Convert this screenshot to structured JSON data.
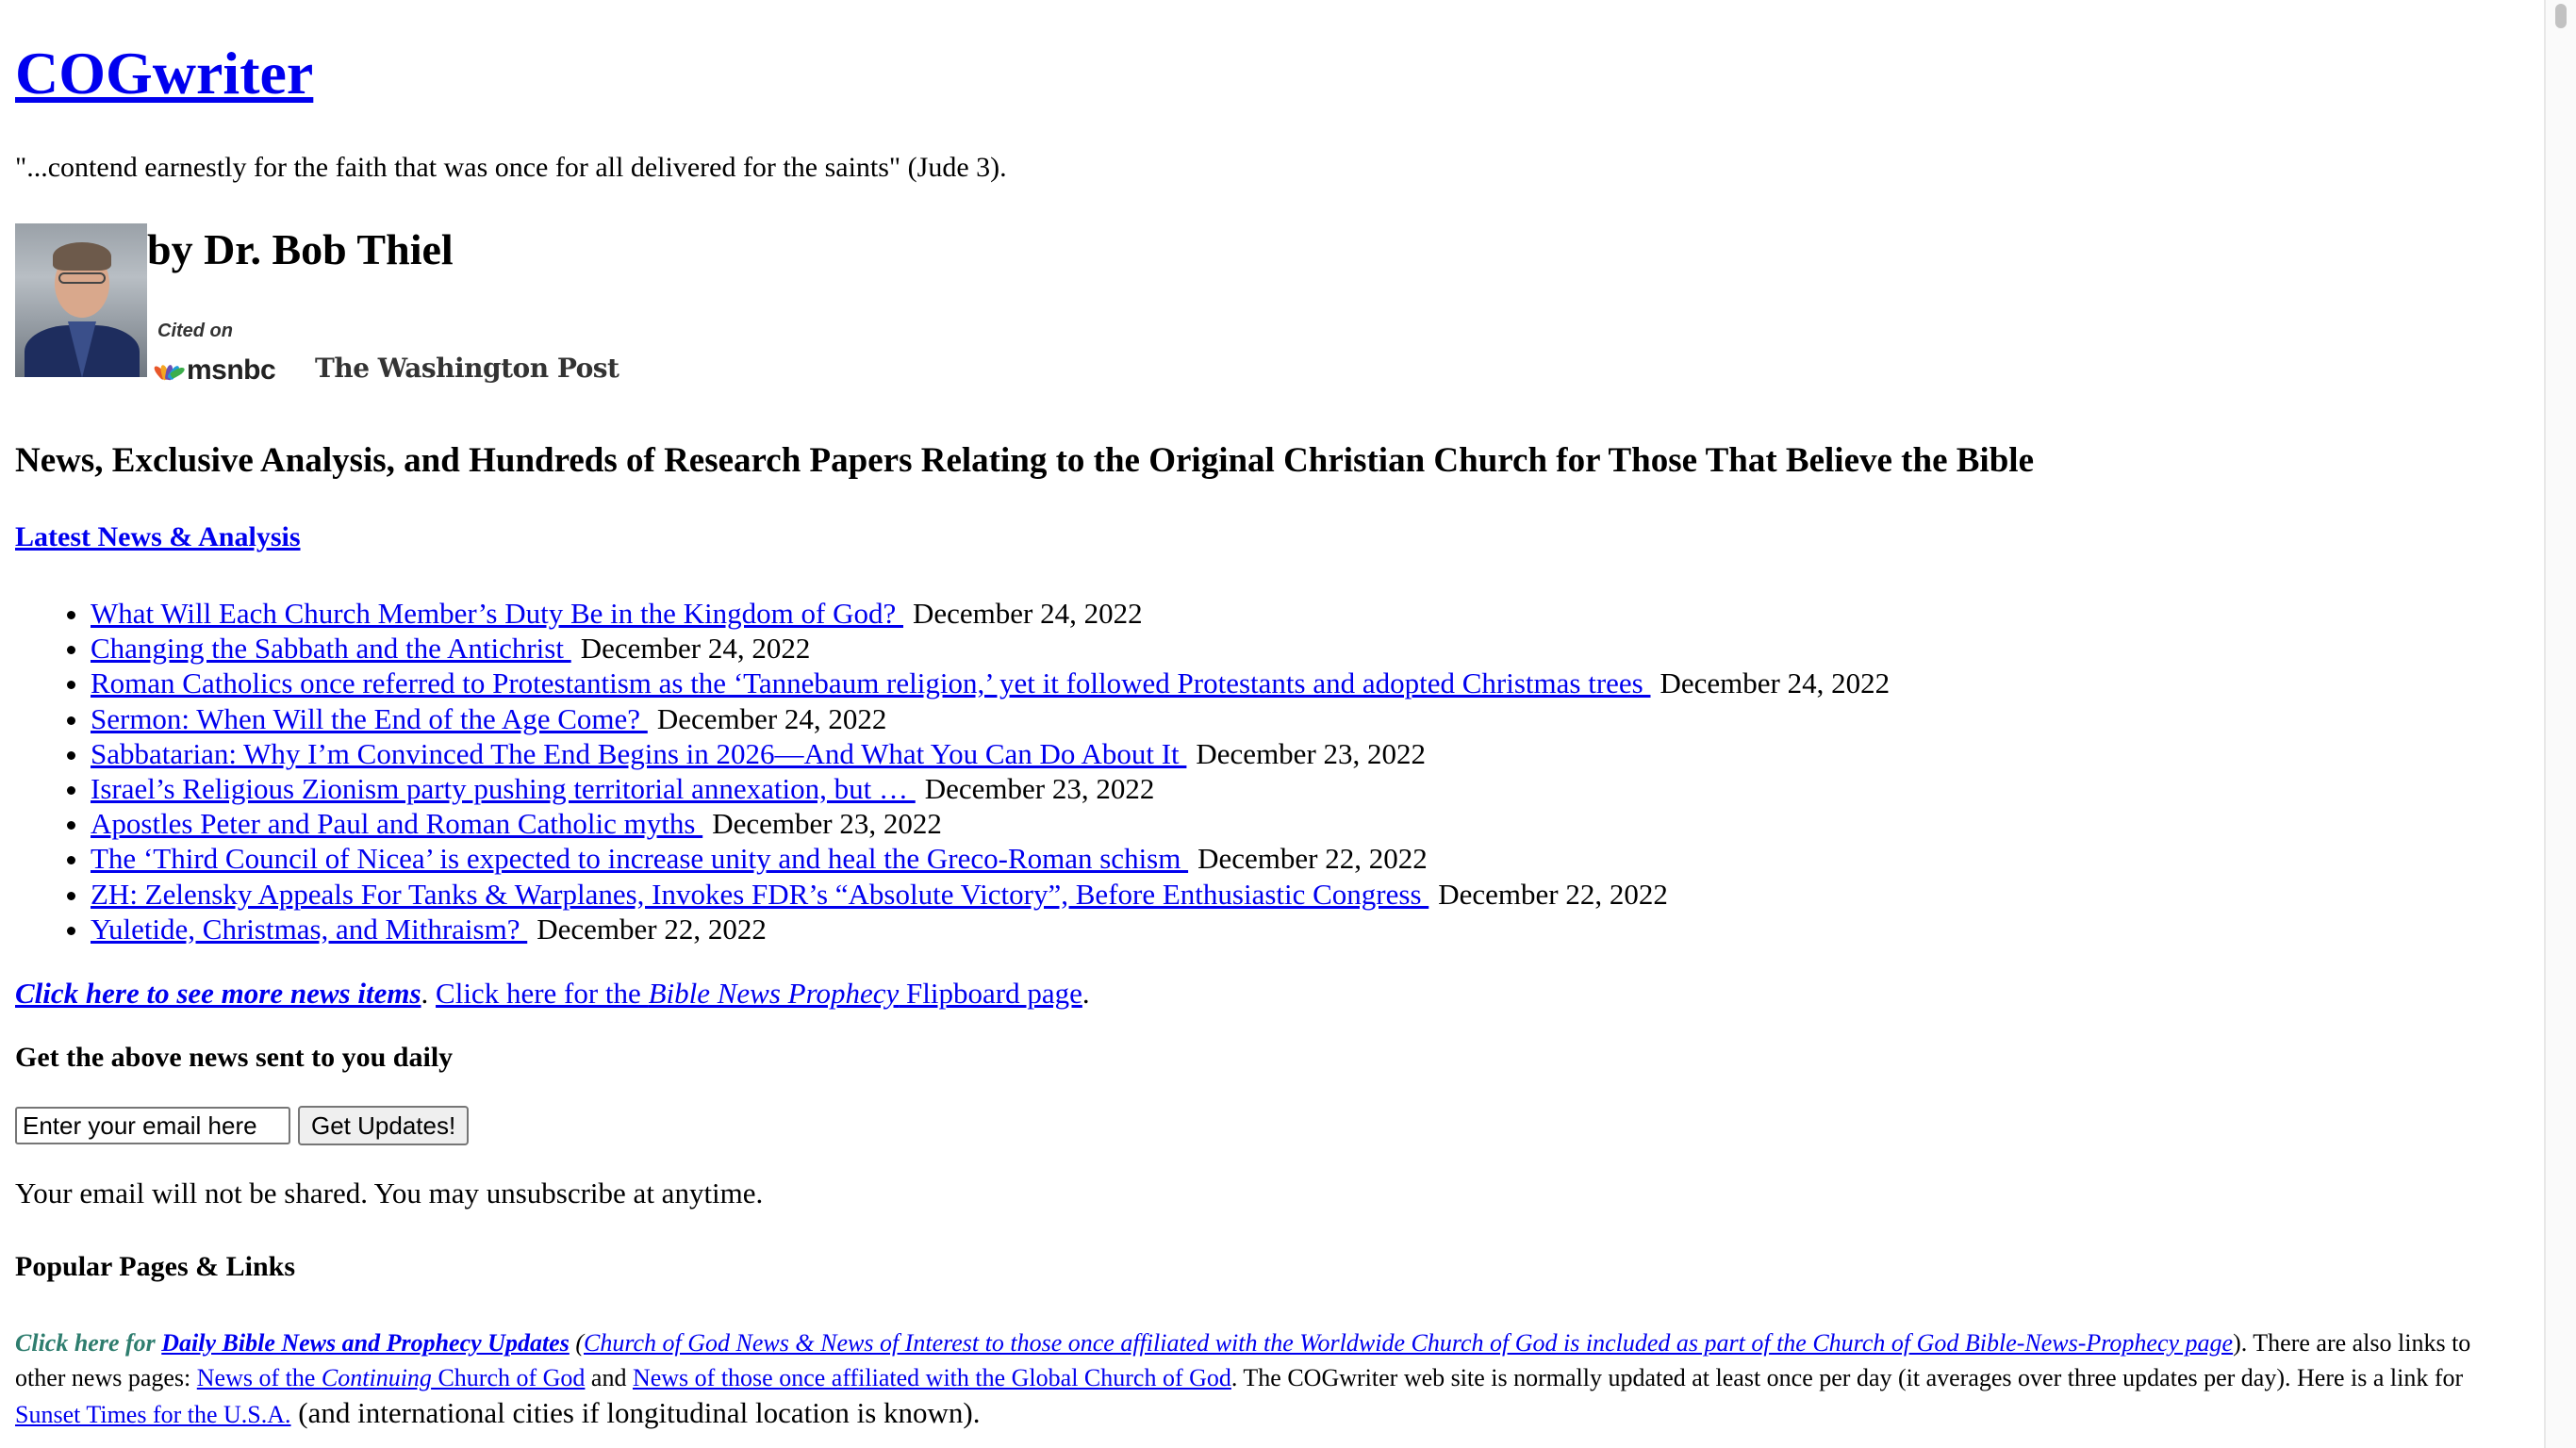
{
  "site": {
    "title": "COGwriter",
    "tagline": "\"...contend earnestly for the faith that was once for all delivered for the saints\" (Jude 3)."
  },
  "author": {
    "name": "by Dr. Bob Thiel",
    "cited_label": "Cited on",
    "outlets": [
      "msnbc",
      "The Washington Post"
    ]
  },
  "headline": "News, Exclusive Analysis, and Hundreds of Research Papers Relating to the Original Christian Church for Those That Believe the Bible",
  "latest_link": "Latest News & Analysis",
  "news_items": [
    {
      "title": "What Will Each Church Member’s Duty Be in the Kingdom of God? ",
      "date": "December 24, 2022"
    },
    {
      "title": "Changing the Sabbath and the Antichrist ",
      "date": "December 24, 2022"
    },
    {
      "title": "Roman Catholics once referred to Protestantism as the ‘Tannebaum religion,’ yet it followed Protestants and adopted Christmas trees ",
      "date": "December 24, 2022"
    },
    {
      "title": "Sermon: When Will the End of the Age Come? ",
      "date": "December 24, 2022"
    },
    {
      "title": "Sabbatarian: Why I’m Convinced The End Begins in 2026—And What You Can Do About It ",
      "date": "December 23, 2022"
    },
    {
      "title": "Israel’s Religious Zionism party pushing territorial annexation, but … ",
      "date": "December 23, 2022"
    },
    {
      "title": "Apostles Peter and Paul and Roman Catholic myths ",
      "date": "December 23, 2022"
    },
    {
      "title": "The ‘Third Council of Nicea’ is expected to increase unity and heal the Greco-Roman schism ",
      "date": "December 22, 2022"
    },
    {
      "title": "ZH: Zelensky Appeals For Tanks & Warplanes, Invokes FDR’s “Absolute Victory”, Before Enthusiastic Congress ",
      "date": "December 22, 2022"
    },
    {
      "title": "Yuletide, Christmas, and Mithraism? ",
      "date": "December 22, 2022"
    }
  ],
  "more": {
    "more_news_label": "Click here to see more news items",
    "sep": ". ",
    "flipboard_prefix": "Click here for the ",
    "flipboard_em": "Bible News Prophecy",
    "flipboard_suffix": " Flipboard page",
    "end": "."
  },
  "signup": {
    "heading": "Get the above news sent to you daily",
    "email_placeholder": "Enter your email here",
    "button_label": "Get Updates!",
    "privacy_note": "Your email will not be shared. You may unsubscribe at anytime."
  },
  "popular": {
    "heading": "Popular Pages & Links",
    "lead_text": "Click here for ",
    "daily_link": "Daily Bible News and Prophecy Updates",
    "paren_open": " (",
    "paren_link": "Church of God News & News of Interest to those once affiliated with the Worldwide Church of God is included as part of the Church of God Bible-News-Prophecy page",
    "after_paren": "). There are also links to other news pages: ",
    "continuing_prefix": "News of the ",
    "continuing_em": "Continuing",
    "continuing_suffix": " Church of God",
    "and_text": " and ",
    "global_link": "News of those once affiliated with the Global Church of God",
    "update_text": ". The COGwriter web site is normally updated at least once per day (it averages over three updates per day). Here is a link for ",
    "sunset_link": "Sunset Times for the U.S.A.",
    "final_text": " (and international cities if longitudinal location is known)."
  },
  "colors": {
    "link": "#0000ee",
    "lead_teal": "#2e7d6e"
  },
  "icons": [
    "author-photo",
    "msnbc-peacock-icon",
    "scrollbar-thumb"
  ]
}
